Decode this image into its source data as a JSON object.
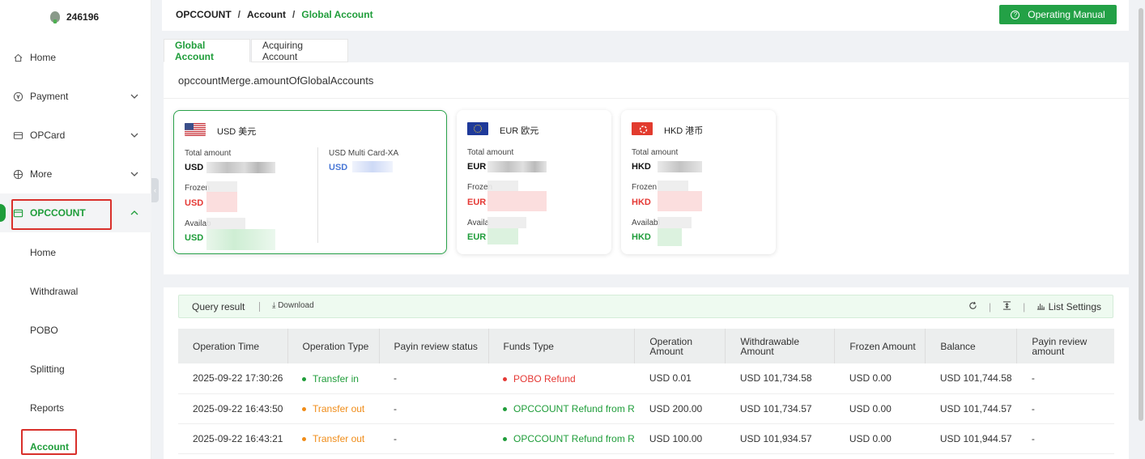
{
  "sidebar": {
    "account_id": "246196",
    "items": [
      {
        "label": "Home",
        "icon": "home-icon"
      },
      {
        "label": "Payment",
        "icon": "payment-icon"
      },
      {
        "label": "OPCard",
        "icon": "card-icon"
      },
      {
        "label": "More",
        "icon": "grid-icon"
      },
      {
        "label": "OPCCOUNT",
        "icon": "wallet-icon"
      }
    ],
    "sub_items": [
      "Home",
      "Withdrawal",
      "POBO",
      "Splitting",
      "Reports",
      "Account"
    ]
  },
  "header": {
    "breadcrumb": [
      "OPCCOUNT",
      "Account",
      "Global Account"
    ],
    "separator": "/",
    "manual_button": "Operating Manual"
  },
  "tabs": [
    "Global Account",
    "Acquiring Account"
  ],
  "summary": {
    "title": "opccountMerge.amountOfGlobalAccounts",
    "cards": [
      {
        "currency": "USD 美元",
        "total_label": "Total amount",
        "total_prefix": "USD",
        "frozen_label": "Frozen",
        "frozen_prefix": "USD",
        "available_label": "Availab",
        "available_prefix": "USD",
        "extra_label": "USD Multi Card-XA",
        "extra_prefix": "USD"
      },
      {
        "currency": "EUR 欧元",
        "total_label": "Total amount",
        "total_prefix": "EUR",
        "frozen_label": "Frozen",
        "frozen_prefix": "EUR",
        "available_label": "Availa",
        "available_prefix": "EUR"
      },
      {
        "currency": "HKD 港币",
        "total_label": "Total amount",
        "total_prefix": "HKD",
        "frozen_label": "Frozen",
        "frozen_prefix": "HKD",
        "available_label": "Availabl",
        "available_prefix": "HKD"
      }
    ]
  },
  "results": {
    "query_label": "Query result",
    "download_label": "Download",
    "list_settings_label": "List Settings",
    "columns": [
      "Operation Time",
      "Operation Type",
      "Payin review status",
      "Funds Type",
      "Operation Amount",
      "Withdrawable Amount",
      "Frozen Amount",
      "Balance",
      "Payin review amount"
    ],
    "rows": [
      [
        "2025-09-22 17:30:26",
        "Transfer in",
        "-",
        "POBO Refund",
        "USD 0.01",
        "USD 101,734.58",
        "USD 0.00",
        "USD 101,744.58",
        "-"
      ],
      [
        "2025-09-22 16:43:50",
        "Transfer out",
        "-",
        "OPCCOUNT Refund from R",
        "USD 200.00",
        "USD 101,734.57",
        "USD 0.00",
        "USD 101,744.57",
        "-"
      ],
      [
        "2025-09-22 16:43:21",
        "Transfer out",
        "-",
        "OPCCOUNT Refund from R",
        "USD 100.00",
        "USD 101,934.57",
        "USD 0.00",
        "USD 101,944.57",
        "-"
      ]
    ],
    "row_type_colors": [
      "green",
      "orange",
      "orange"
    ],
    "row_fund_colors": [
      "red",
      "green",
      "green"
    ]
  },
  "colors": {
    "accent": "#1f9d3a",
    "highlight_box": "#d9302b",
    "warning": "#f08c18",
    "danger": "#e53935"
  }
}
